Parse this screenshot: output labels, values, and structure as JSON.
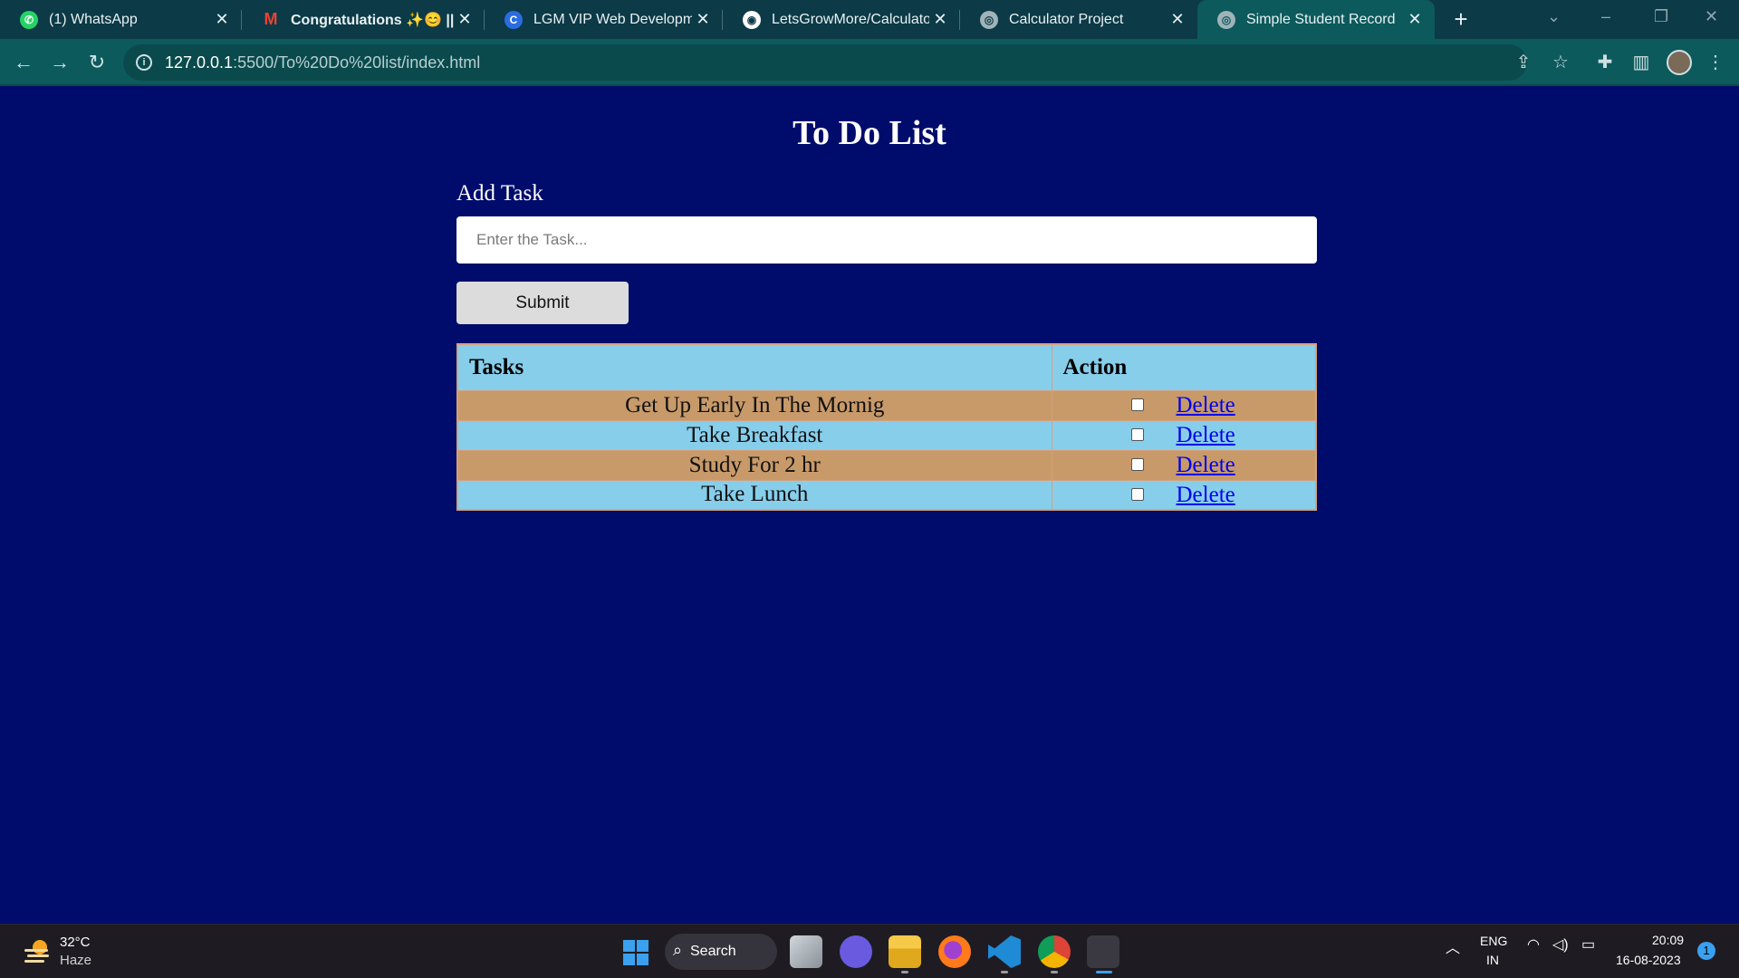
{
  "browser": {
    "tabs": [
      {
        "title": "(1) WhatsApp",
        "icon": "whatsapp-icon",
        "active": false
      },
      {
        "title": "Congratulations ✨😊 || Of",
        "icon": "gmail-icon",
        "active": false
      },
      {
        "title": "LGM VIP Web Development",
        "icon": "lgm-icon",
        "active": false
      },
      {
        "title": "LetsGrowMore/Calculator.jp",
        "icon": "github-icon",
        "active": false
      },
      {
        "title": "Calculator Project",
        "icon": "globe-icon",
        "active": false
      },
      {
        "title": "Simple Student Record",
        "icon": "globe-icon",
        "active": true
      }
    ],
    "url_host": "127.0.0.1",
    "url_path": ":5500/To%20Do%20list/index.html"
  },
  "page": {
    "title": "To Do List",
    "add_label": "Add Task",
    "input_placeholder": "Enter the Task...",
    "input_value": "",
    "submit_label": "Submit",
    "table": {
      "headers": [
        "Tasks",
        "Action"
      ],
      "rows": [
        {
          "task": "Get Up Early In The Mornig",
          "checked": false,
          "action": "Delete"
        },
        {
          "task": "Take Breakfast",
          "checked": false,
          "action": "Delete"
        },
        {
          "task": "Study For 2 hr",
          "checked": false,
          "action": "Delete"
        },
        {
          "task": "Take Lunch",
          "checked": false,
          "action": "Delete"
        }
      ],
      "header_color": "#87ceeb",
      "row_colors": [
        "#c89a6a",
        "#87ceeb"
      ]
    },
    "background": "#000c6b"
  },
  "taskbar": {
    "weather_temp": "32°C",
    "weather_desc": "Haze",
    "search_label": "Search",
    "lang_line1": "ENG",
    "lang_line2": "IN",
    "time": "20:09",
    "date": "16-08-2023",
    "notification_count": "1"
  }
}
